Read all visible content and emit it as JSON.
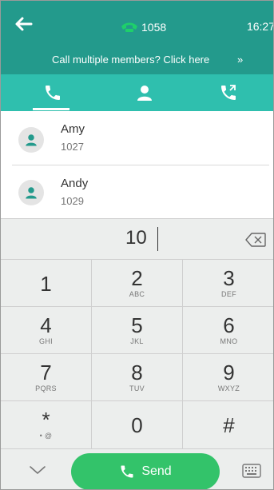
{
  "status": {
    "line_number": "1058",
    "time": "16:27"
  },
  "banner": {
    "text": "Call multiple members? Click here",
    "arrow": "»"
  },
  "tabs": [
    {
      "id": "dial",
      "icon": "phone-icon",
      "active": true
    },
    {
      "id": "directory",
      "icon": "contact-icon",
      "active": false
    },
    {
      "id": "history",
      "icon": "call-history-icon",
      "active": false
    }
  ],
  "contacts": [
    {
      "name": "Amy",
      "number": "1027"
    },
    {
      "name": "Andy",
      "number": "1029"
    }
  ],
  "dial": {
    "value": "10"
  },
  "keypad": [
    {
      "digit": "1",
      "letters": ""
    },
    {
      "digit": "2",
      "letters": "ABC"
    },
    {
      "digit": "3",
      "letters": "DEF"
    },
    {
      "digit": "4",
      "letters": "GHI"
    },
    {
      "digit": "5",
      "letters": "JKL"
    },
    {
      "digit": "6",
      "letters": "MNO"
    },
    {
      "digit": "7",
      "letters": "PQRS"
    },
    {
      "digit": "8",
      "letters": "TUV"
    },
    {
      "digit": "9",
      "letters": "WXYZ"
    },
    {
      "digit": "*",
      "letters": "• @"
    },
    {
      "digit": "0",
      "letters": ""
    },
    {
      "digit": "#",
      "letters": ""
    }
  ],
  "bottom": {
    "send_label": "Send"
  },
  "colors": {
    "header": "#239a8c",
    "tabs": "#2fbfae",
    "send": "#33c36a",
    "keypad_bg": "#eceeed"
  }
}
